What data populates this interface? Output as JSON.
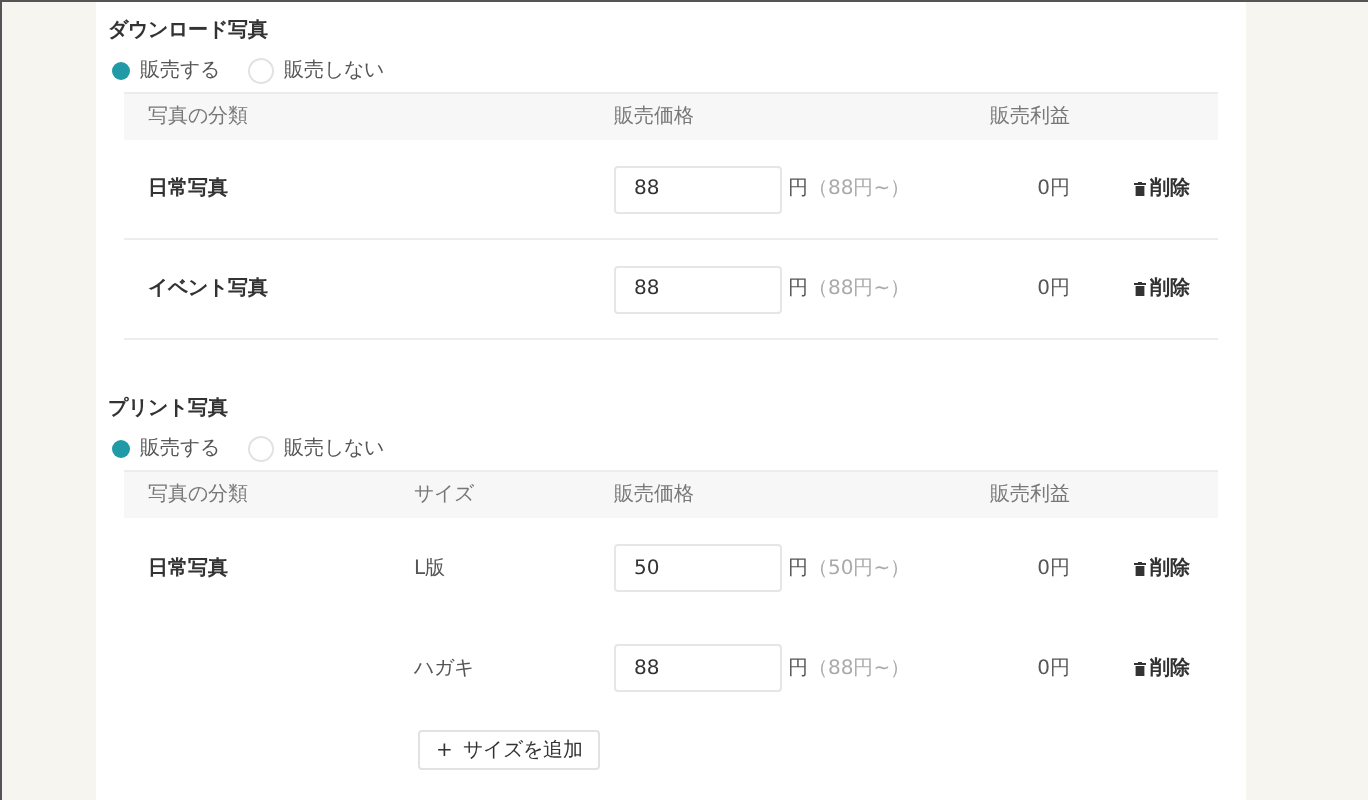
{
  "sections": [
    {
      "title": "ダウンロード写真",
      "radios": [
        {
          "label": "販売する",
          "selected": true
        },
        {
          "label": "販売しない",
          "selected": false
        }
      ],
      "columns": [
        {
          "kind": "category",
          "label": "写真の分類"
        },
        {
          "kind": "price",
          "label": "販売価格"
        },
        {
          "kind": "profit",
          "label": "販売利益"
        }
      ],
      "rows": [
        {
          "category": "日常写真",
          "price": "88",
          "unit": "円",
          "hint": "（88円~）",
          "profit": "0円",
          "delete": "削除"
        },
        {
          "category": "イベント写真",
          "price": "88",
          "unit": "円",
          "hint": "（88円~）",
          "profit": "0円",
          "delete": "削除"
        }
      ]
    },
    {
      "title": "プリント写真",
      "radios": [
        {
          "label": "販売する",
          "selected": true
        },
        {
          "label": "販売しない",
          "selected": false
        }
      ],
      "columns": [
        {
          "kind": "category",
          "label": "写真の分類"
        },
        {
          "kind": "size",
          "label": "サイズ"
        },
        {
          "kind": "price",
          "label": "販売価格"
        },
        {
          "kind": "profit",
          "label": "販売利益"
        }
      ],
      "rows": [
        {
          "category": "日常写真",
          "size": "L版",
          "price": "50",
          "unit": "円",
          "hint": "（50円~）",
          "profit": "0円",
          "delete": "削除"
        },
        {
          "size": "ハガキ",
          "price": "88",
          "unit": "円",
          "hint": "（88円~）",
          "profit": "0円",
          "delete": "削除"
        }
      ],
      "add_button": {
        "icon": "+",
        "label": "サイズを追加"
      }
    }
  ]
}
